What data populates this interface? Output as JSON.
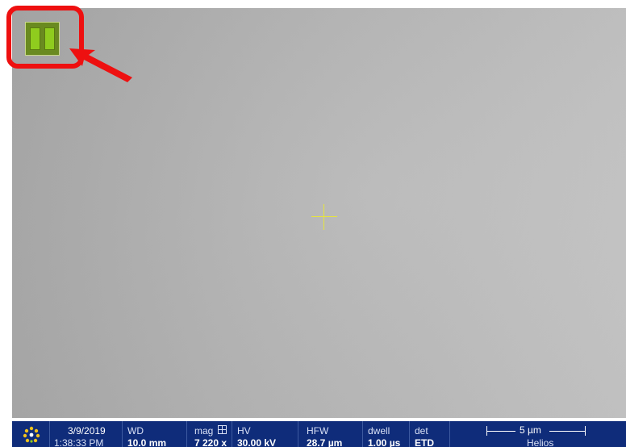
{
  "view": {
    "pause_icon": "pause-icon",
    "crosshair_icon": "crosshair-icon",
    "annotation": {
      "highlight_color": "#ee1010",
      "arrow_icon": "arrow-icon"
    }
  },
  "status_bar": {
    "logo_icon": "fei-logo-icon",
    "date": "3/9/2019",
    "time": "1:38:33 PM",
    "wd_label": "WD",
    "wd_value": "10.0 mm",
    "mag_label": "mag",
    "mag_value": "7 220 x",
    "hv_label": "HV",
    "hv_value": "30.00 kV",
    "hfw_label": "HFW",
    "hfw_value": "28.7 µm",
    "dwell_label": "dwell",
    "dwell_value": "1.00 µs",
    "det_label": "det",
    "det_value": "ETD",
    "scale_label": "5 µm",
    "instrument": "Helios",
    "background_color": "#0f2c7a"
  }
}
